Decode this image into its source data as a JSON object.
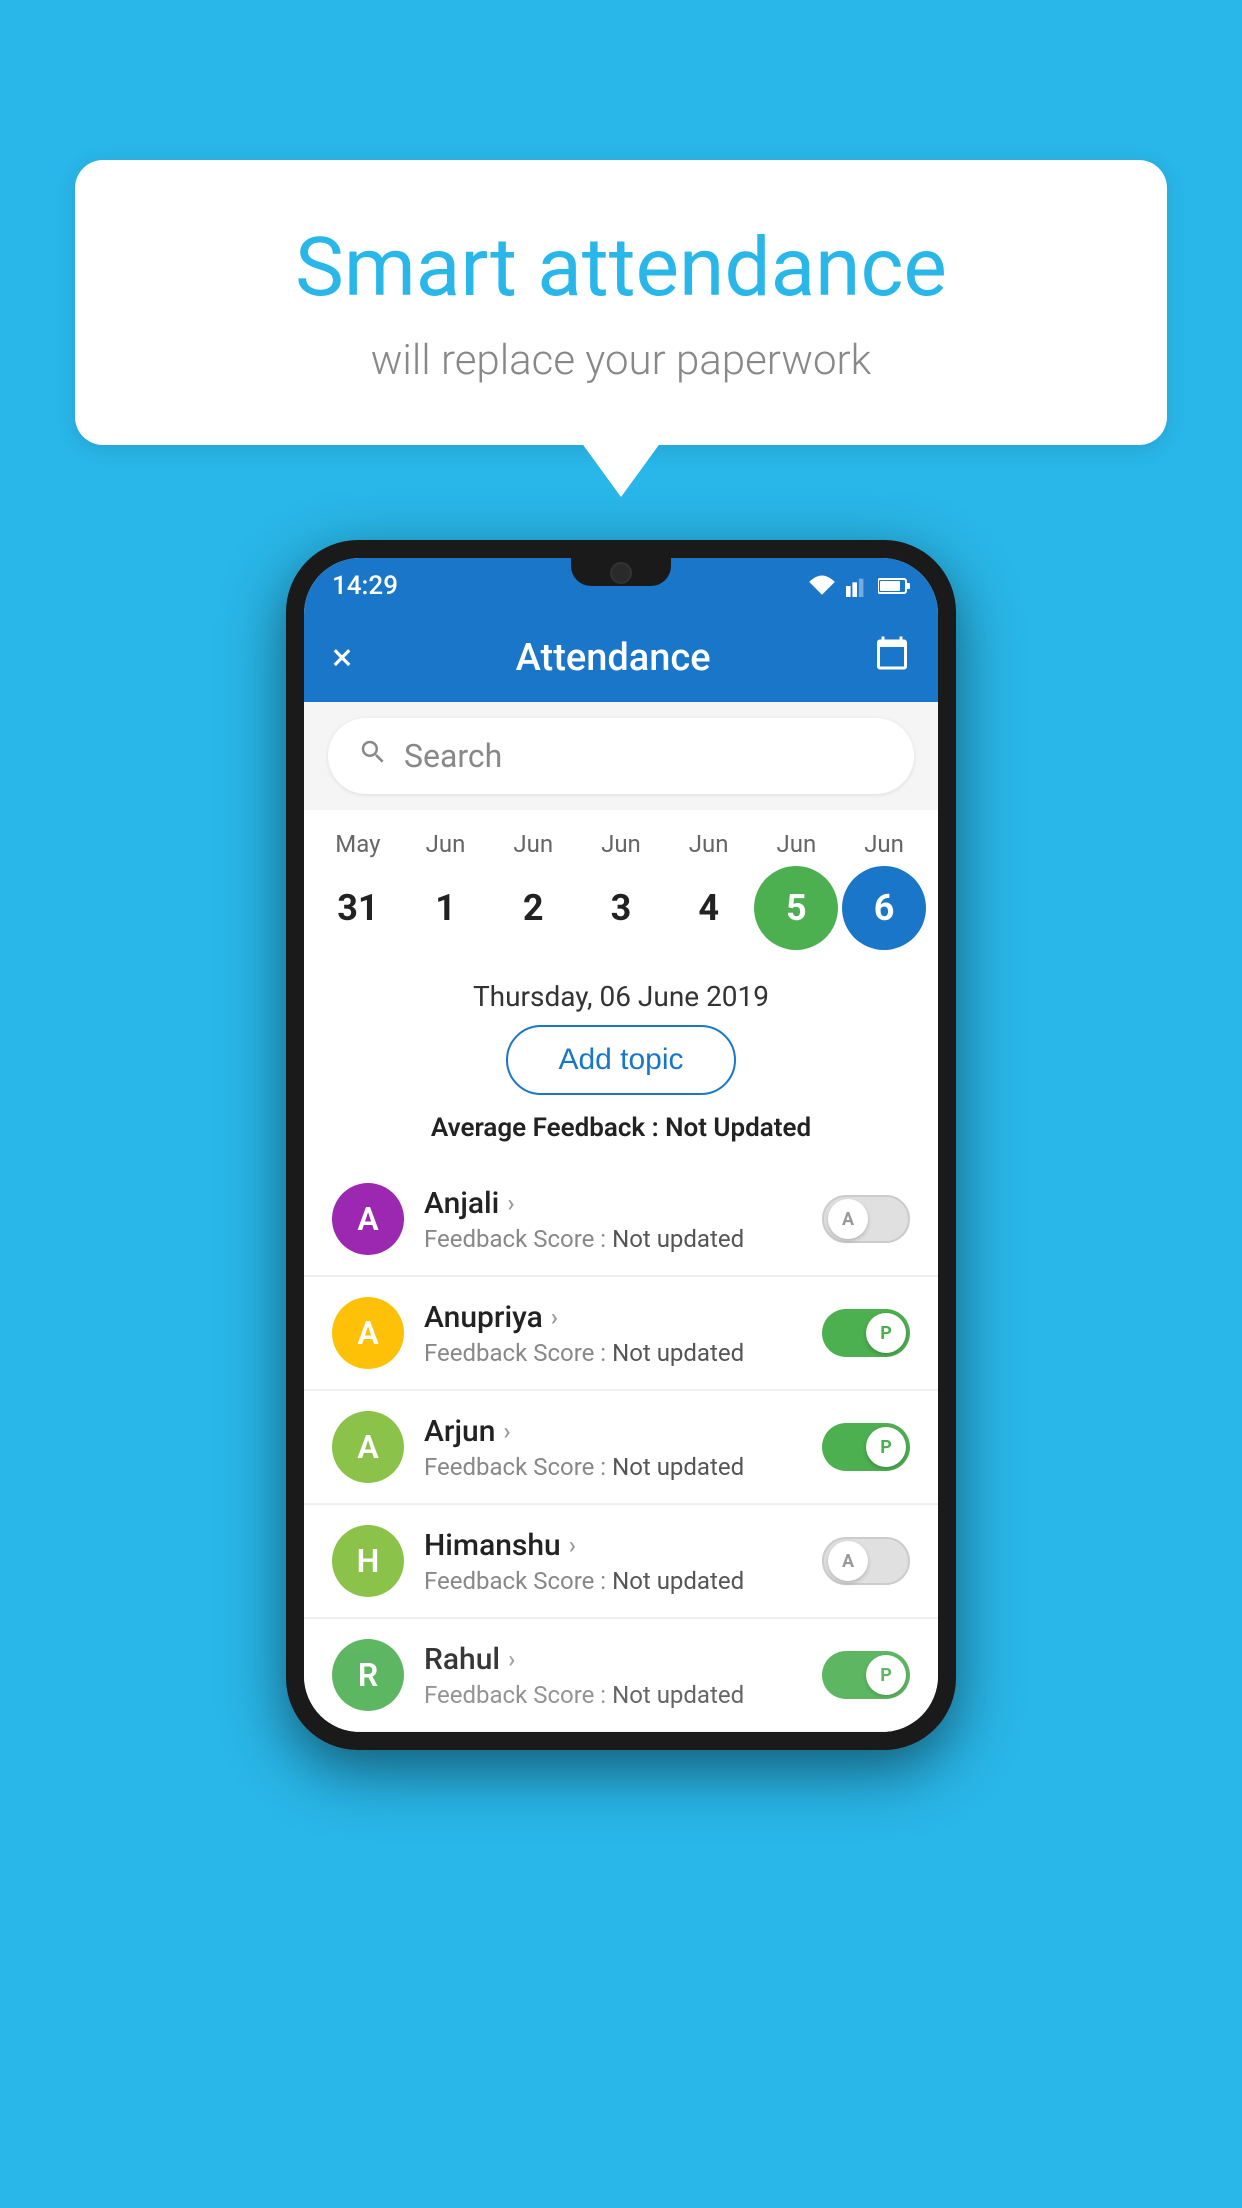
{
  "background_color": "#29b6e8",
  "bubble": {
    "title": "Smart attendance",
    "subtitle": "will replace your paperwork"
  },
  "phone": {
    "status_bar": {
      "time": "14:29",
      "icons": [
        "wifi",
        "signal",
        "battery"
      ]
    },
    "app_bar": {
      "title": "Attendance",
      "close_label": "×",
      "calendar_label": "📅"
    },
    "search": {
      "placeholder": "Search"
    },
    "calendar": {
      "months": [
        "May",
        "Jun",
        "Jun",
        "Jun",
        "Jun",
        "Jun",
        "Jun"
      ],
      "dates": [
        "31",
        "1",
        "2",
        "3",
        "4",
        "5",
        "6"
      ],
      "today_index": 5,
      "selected_index": 6
    },
    "selected_date": "Thursday, 06 June 2019",
    "add_topic_label": "Add topic",
    "avg_feedback_label": "Average Feedback : ",
    "avg_feedback_value": "Not Updated",
    "students": [
      {
        "name": "Anjali",
        "avatar_letter": "A",
        "avatar_color": "#9c27b0",
        "feedback_label": "Feedback Score : ",
        "feedback_value": "Not updated",
        "toggle_state": "off",
        "toggle_label": "A"
      },
      {
        "name": "Anupriya",
        "avatar_letter": "A",
        "avatar_color": "#ffc107",
        "feedback_label": "Feedback Score : ",
        "feedback_value": "Not updated",
        "toggle_state": "on",
        "toggle_label": "P"
      },
      {
        "name": "Arjun",
        "avatar_letter": "A",
        "avatar_color": "#8bc34a",
        "feedback_label": "Feedback Score : ",
        "feedback_value": "Not updated",
        "toggle_state": "on",
        "toggle_label": "P"
      },
      {
        "name": "Himanshu",
        "avatar_letter": "H",
        "avatar_color": "#8bc34a",
        "feedback_label": "Feedback Score : ",
        "feedback_value": "Not updated",
        "toggle_state": "off",
        "toggle_label": "A"
      },
      {
        "name": "Rahul",
        "avatar_letter": "R",
        "avatar_color": "#4caf50",
        "feedback_label": "Feedback Score : ",
        "feedback_value": "Not updated",
        "toggle_state": "on",
        "toggle_label": "P"
      }
    ]
  }
}
